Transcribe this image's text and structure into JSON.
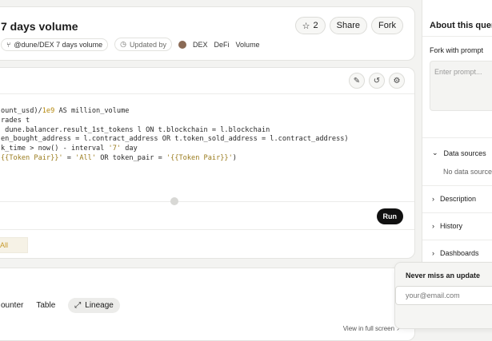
{
  "header": {
    "title": "7 days volume",
    "star_count": "2",
    "share_label": "Share",
    "fork_label": "Fork",
    "author_chip": "@dune/DEX 7 days volume",
    "updated_label": "Updated by",
    "tags": [
      "DEX",
      "DeFi",
      "Volume"
    ]
  },
  "editor": {
    "code_lines": [
      {
        "a": "ount_usd)/",
        "num": "1e9",
        "b": " AS million_volume"
      },
      {
        "a": "rades t"
      },
      {
        "a": " dune.balancer.result_1st_tokens l ON t.blockchain = l.blockchain"
      },
      {
        "a": "en_bought_address = l.contract_address OR t.token_sold_address = l.contract_address)"
      },
      {
        "a": "k_time > now() - interval ",
        "str": "'7'",
        "b": " day"
      },
      {
        "a": "",
        "str": "{{Token Pair}}'",
        "b": " = ",
        "str2": "'All'",
        "c": " OR token_pair = ",
        "str3": "'{{Token Pair}}'",
        "d": ")"
      }
    ],
    "run_label": "Run",
    "param_value": "All"
  },
  "results": {
    "tabs": [
      "ounter",
      "Table",
      "Lineage"
    ],
    "view_link": "View in full screen ↗"
  },
  "sidebar": {
    "about_title": "About this query",
    "fork_prompt_label": "Fork with prompt",
    "prompt_placeholder": "Enter prompt...",
    "sections": [
      "Data sources",
      "Description",
      "History",
      "Dashboards"
    ],
    "no_data_text": "No data sources"
  },
  "popup": {
    "title": "Never miss an update",
    "email_placeholder": "your@email.com"
  }
}
